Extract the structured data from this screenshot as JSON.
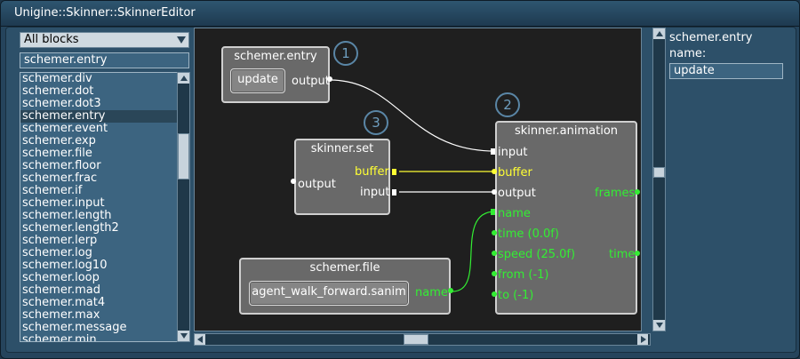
{
  "window": {
    "title": "Unigine::Skinner::SkinnerEditor"
  },
  "left": {
    "filter_select": "All blocks",
    "search_value": "schemer.entry",
    "items": [
      "schemer.div",
      "schemer.dot",
      "schemer.dot3",
      "schemer.entry",
      "schemer.event",
      "schemer.exp",
      "schemer.file",
      "schemer.floor",
      "schemer.frac",
      "schemer.if",
      "schemer.input",
      "schemer.length",
      "schemer.length2",
      "schemer.lerp",
      "schemer.log",
      "schemer.log10",
      "schemer.loop",
      "schemer.mad",
      "schemer.mat4",
      "schemer.max",
      "schemer.message",
      "schemer.min"
    ]
  },
  "canvas": {
    "entry": {
      "title": "schemer.entry",
      "button": "update",
      "out": "output",
      "badge": "1"
    },
    "set": {
      "title": "skinner.set",
      "buffer": "buffer",
      "input": "input",
      "output": "output",
      "badge": "3"
    },
    "anim": {
      "title": "skinner.animation",
      "badge": "2",
      "input": "input",
      "buffer": "buffer",
      "output": "output",
      "frames": "frames",
      "name": "name",
      "time": "time (0.0f)",
      "speed": "speed (25.0f)",
      "time_out": "time",
      "from": "from (-1)",
      "to": "to (-1)"
    },
    "file": {
      "title": "schemer.file",
      "button": "agent_walk_forward.sanim",
      "name": "name"
    }
  },
  "right": {
    "block_name": "schemer.entry",
    "name_label": "name:",
    "name_value": "update"
  },
  "colors": {
    "wire_white": "#ffffff",
    "wire_yellow": "#ffff33",
    "wire_green": "#33ee33"
  }
}
